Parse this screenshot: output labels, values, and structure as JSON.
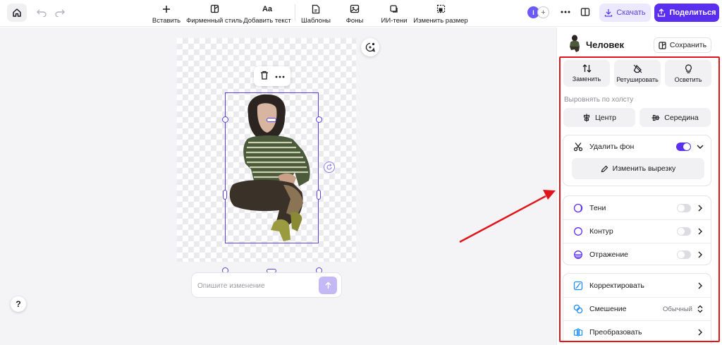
{
  "toolbar": {
    "insert": "Вставить",
    "brand_style": "Фирменный стиль",
    "add_text_icon": "Aa",
    "add_text": "Добавить текст",
    "templates": "Шаблоны",
    "backgrounds": "Фоны",
    "ai_shadows": "ИИ-тени",
    "resize": "Изменить размер",
    "avatar_initial": "I",
    "download": "Скачать",
    "share": "Поделиться"
  },
  "canvas": {
    "prompt_placeholder": "Опишите изменение",
    "help": "?"
  },
  "panel": {
    "title": "Человек",
    "save": "Сохранить",
    "actions": [
      "Заменить",
      "Ретушировать",
      "Осветить"
    ],
    "align_label": "Выровнять по холсту",
    "align_center": "Центр",
    "align_middle": "Середина",
    "remove_bg": {
      "label": "Удалить фон",
      "enabled": true
    },
    "edit_cutout": "Изменить вырезку",
    "effects": [
      {
        "label": "Тени",
        "enabled": false
      },
      {
        "label": "Контур",
        "enabled": false
      },
      {
        "label": "Отражение",
        "enabled": false
      }
    ],
    "adjust": "Корректировать",
    "blend": {
      "label": "Смешение",
      "value": "Обычный"
    },
    "transform": "Преобразовать"
  },
  "colors": {
    "accent": "#5b2ff0",
    "annotation": "#e0141a"
  }
}
